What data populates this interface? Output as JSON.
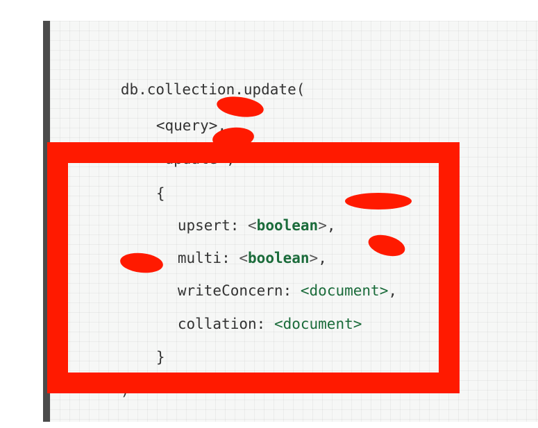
{
  "code": {
    "lines": [
      {
        "name": "line-open-call",
        "text": "db.collection.update("
      },
      {
        "name": "line-query",
        "text": "<query>,"
      },
      {
        "name": "line-update",
        "text": "<update>,"
      },
      {
        "name": "line-options-open",
        "text": "{"
      },
      {
        "name": "line-upsert",
        "key": "upsert: ",
        "lt": "<",
        "value": "boolean",
        "gt": ">",
        "tail": ","
      },
      {
        "name": "line-multi",
        "key": "multi: ",
        "lt": "<",
        "value": "boolean",
        "gt": ">",
        "tail": ","
      },
      {
        "name": "line-write-concern",
        "key": "writeConcern: ",
        "lt": "<",
        "value": "document",
        "gt": ">",
        "tail": ","
      },
      {
        "name": "line-collation",
        "key": "collation: ",
        "lt": "<",
        "value": "document",
        "gt": ">",
        "tail": ""
      },
      {
        "name": "line-options-close",
        "text": "}"
      },
      {
        "name": "line-close-call",
        "text": ")"
      }
    ]
  },
  "colors": {
    "highlight": "#ff1a00",
    "keyword": "#1a6b3a",
    "text": "#333333",
    "panel_bar": "#4b4b4b"
  }
}
